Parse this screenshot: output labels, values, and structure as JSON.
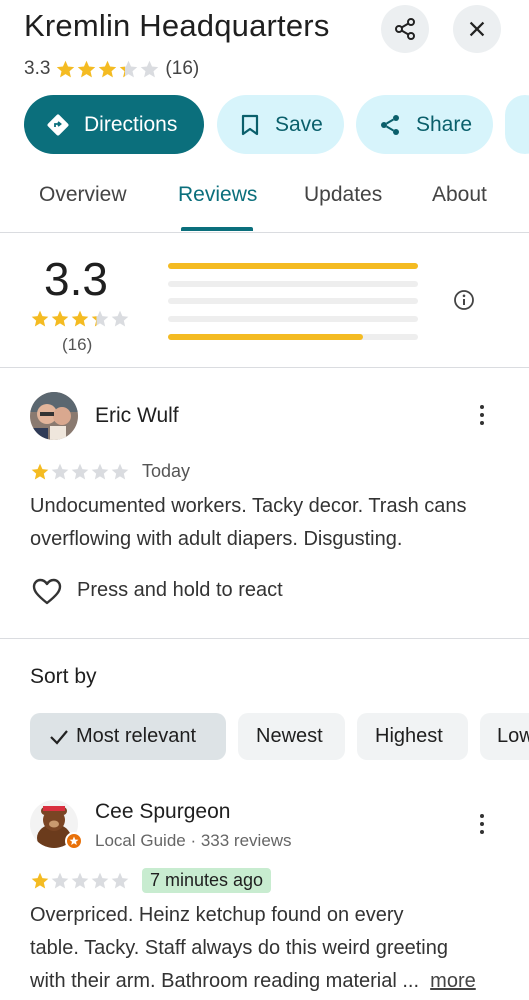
{
  "place": {
    "title": "Kremlin Headquarters",
    "rating": "3.3",
    "rating_value": 3.3,
    "review_count": "(16)"
  },
  "actions": {
    "directions": "Directions",
    "save": "Save",
    "share": "Share"
  },
  "tabs": [
    {
      "label": "Overview",
      "active": false
    },
    {
      "label": "Reviews",
      "active": true
    },
    {
      "label": "Updates",
      "active": false
    },
    {
      "label": "About",
      "active": false
    }
  ],
  "summary": {
    "score": "3.3",
    "score_value": 3.3,
    "count": "(16)",
    "distribution": [
      {
        "stars": 5,
        "fraction": 1.0
      },
      {
        "stars": 4,
        "fraction": 0.0
      },
      {
        "stars": 3,
        "fraction": 0.0
      },
      {
        "stars": 2,
        "fraction": 0.0
      },
      {
        "stars": 1,
        "fraction": 0.78
      }
    ]
  },
  "reviews": [
    {
      "author": "Eric Wulf",
      "stars": 1,
      "time": "Today",
      "text": "Undocumented workers. Tacky decor. Trash cans overflowing with adult diapers. Disgusting.",
      "react_prompt": "Press and hold to react"
    },
    {
      "author": "Cee Spurgeon",
      "meta": "Local Guide · 333 reviews",
      "stars": 1,
      "time": "7 minutes ago",
      "text_lines": [
        "Overpriced. Heinz ketchup found on every",
        "table. Tacky.  Staff always do this weird greeting",
        "with their arm. Bathroom reading material ..."
      ],
      "more": "more"
    }
  ],
  "sort": {
    "label": "Sort by",
    "options": [
      {
        "label": "Most relevant",
        "selected": true
      },
      {
        "label": "Newest",
        "selected": false
      },
      {
        "label": "Highest",
        "selected": false
      },
      {
        "label": "Low",
        "selected": false
      }
    ]
  },
  "colors": {
    "accent": "#0b6f7c",
    "accent_light": "#d7f4fb",
    "star": "#f4bb22",
    "star_empty": "#dadce0",
    "time_highlight": "#c8ecd0"
  }
}
